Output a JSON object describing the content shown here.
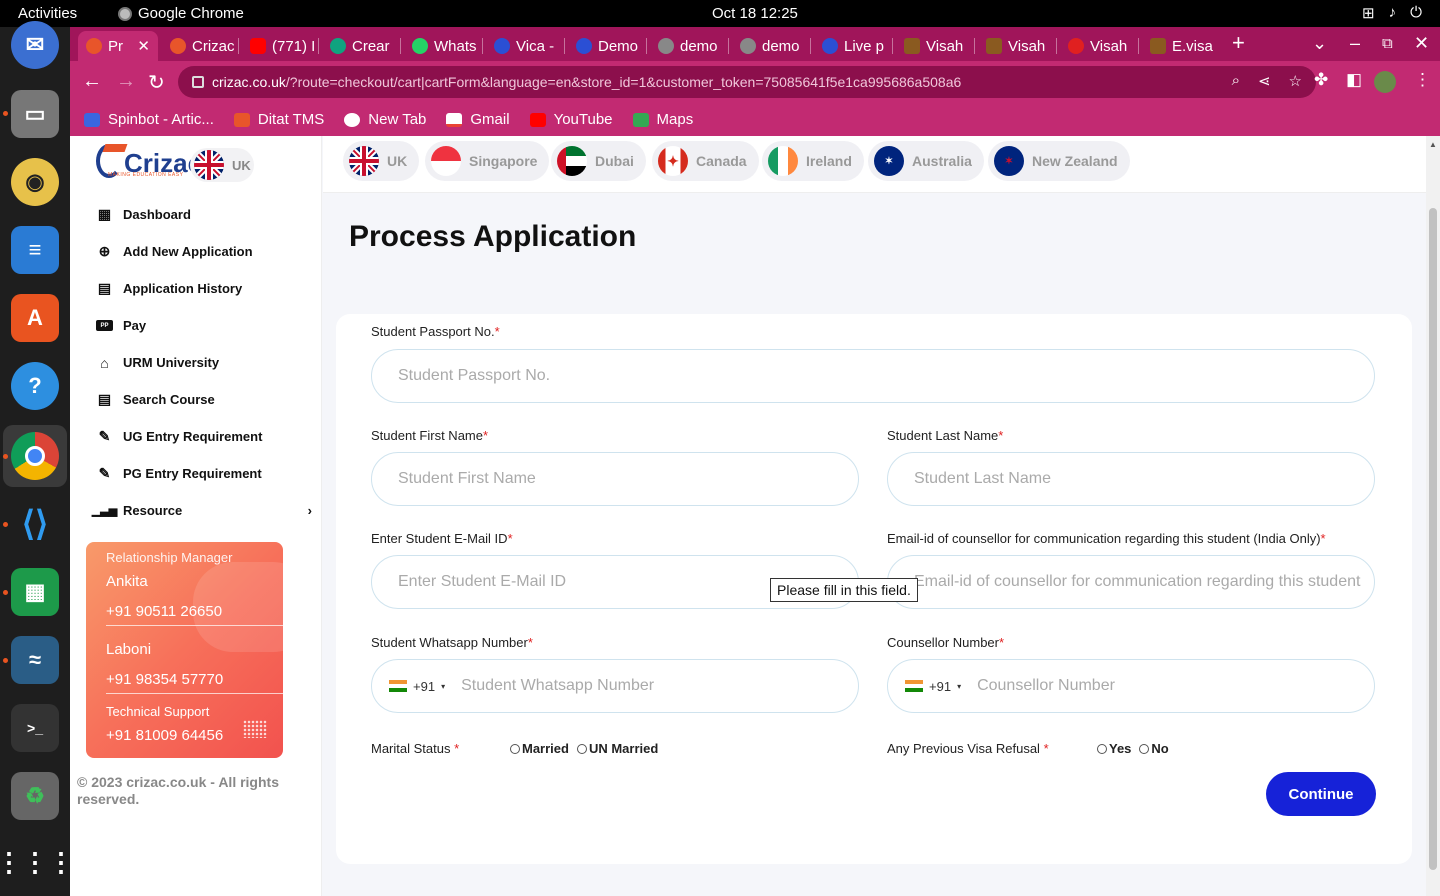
{
  "system": {
    "activities": "Activities",
    "app_name": "Google Chrome",
    "clock": "Oct 18  12:25"
  },
  "browser": {
    "tabs": [
      {
        "label": "Pr",
        "color": "#e8552a"
      },
      {
        "label": "Crizac",
        "color": "#e8552a"
      },
      {
        "label": "(771) I",
        "color": "#ff0000"
      },
      {
        "label": "Crear",
        "color": "#10a37f"
      },
      {
        "label": "Whats",
        "color": "#25d366"
      },
      {
        "label": "Vica -",
        "color": "#2b4fd4"
      },
      {
        "label": "Demo",
        "color": "#2b4fd4"
      },
      {
        "label": "demo",
        "color": "#888888"
      },
      {
        "label": "demo",
        "color": "#888888"
      },
      {
        "label": "Live p",
        "color": "#2b4fd4"
      },
      {
        "label": "Visah",
        "color": "#8a5a20"
      },
      {
        "label": "Visah",
        "color": "#8a5a20"
      },
      {
        "label": "Visah",
        "color": "#e02020"
      },
      {
        "label": "E.visa",
        "color": "#8a5a20"
      }
    ],
    "url_main": "crizac.co.uk",
    "url_rest": "/?route=checkout/cart|cartForm&language=en&store_id=1&customer_token=75085641f5e1ca995686a508a6",
    "bookmarks": [
      {
        "label": "Spinbot - Artic...",
        "color": "#3a66e0"
      },
      {
        "label": "Ditat TMS",
        "color": "#e8552a"
      },
      {
        "label": "New Tab",
        "color": "#ffffff"
      },
      {
        "label": "Gmail",
        "color": "#ea4335"
      },
      {
        "label": "YouTube",
        "color": "#ff0000"
      },
      {
        "label": "Maps",
        "color": "#34a853"
      }
    ]
  },
  "sidebar": {
    "logo": "Crizac",
    "logo_tagline": "MAKING EDUCATION EASY",
    "country": "UK",
    "menu": [
      {
        "label": "Dashboard",
        "icon": "grid-icon"
      },
      {
        "label": "Add New Application",
        "icon": "search-plus-icon"
      },
      {
        "label": "Application History",
        "icon": "book-icon"
      },
      {
        "label": "Pay",
        "icon": "paypal-icon"
      },
      {
        "label": "URM University",
        "icon": "bank-icon"
      },
      {
        "label": "Search Course",
        "icon": "book-icon"
      },
      {
        "label": "UG Entry Requirement",
        "icon": "edit-icon"
      },
      {
        "label": "PG Entry Requirement",
        "icon": "edit-icon"
      },
      {
        "label": "Resource",
        "icon": "signal-icon"
      }
    ],
    "rm_card": {
      "title": "Relationship Manager",
      "name1": "Ankita",
      "phone1": "+91 90511 26650",
      "name2": "Laboni",
      "phone2": "+91 98354 57770",
      "support_title": "Technical Support",
      "support_phone": "+91 81009 64456"
    },
    "copyright": "© 2023 crizac.co.uk - All rights reserved."
  },
  "countries": [
    "UK",
    "Singapore",
    "Dubai",
    "Canada",
    "Ireland",
    "Australia",
    "New Zealand"
  ],
  "form": {
    "title": "Process Application",
    "passport_label": "Student Passport No.",
    "passport_placeholder": "Student Passport No.",
    "first_name_label": "Student First Name",
    "first_name_placeholder": "Student First Name",
    "last_name_label": "Student Last Name",
    "last_name_placeholder": "Student Last Name",
    "email_label": "Enter Student E-Mail ID",
    "email_placeholder": "Enter Student E-Mail ID",
    "counsellor_email_label": "Email-id of counsellor for communication regarding this student (India Only)",
    "counsellor_email_placeholder": "Email-id of counsellor for communication regarding this student",
    "whatsapp_label": "Student Whatsapp Number",
    "whatsapp_placeholder": "Student Whatsapp Number",
    "counsellor_number_label": "Counsellor Number",
    "counsellor_number_placeholder": "Counsellor Number",
    "dial_code": "+91",
    "marital_label": "Marital Status",
    "marital_options": [
      "Married",
      "UN Married"
    ],
    "refusal_label": "Any Previous Visa Refusal",
    "refusal_options": [
      "Yes",
      "No"
    ],
    "required_mark": "*",
    "tooltip": "Please fill in this field.",
    "continue": "Continue"
  }
}
